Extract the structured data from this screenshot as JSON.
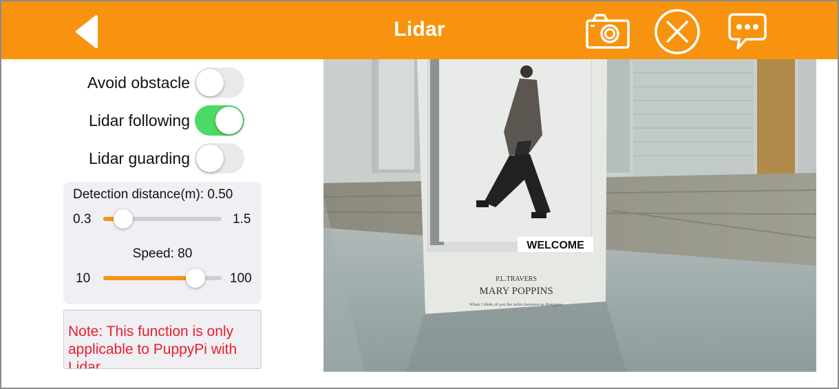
{
  "header": {
    "title": "Lidar",
    "back_icon": "back-arrow-icon",
    "camera_icon": "camera-icon",
    "close_icon": "close-circle-icon",
    "chat_icon": "chat-bubble-icon",
    "color": "#f7930f"
  },
  "toggles": [
    {
      "label": "Avoid obstacle",
      "on": false
    },
    {
      "label": "Lidar following",
      "on": true
    },
    {
      "label": "Lidar guarding",
      "on": false
    }
  ],
  "detection": {
    "label": "Detection distance(m): 0.50",
    "min": "0.3",
    "max": "1.5",
    "value": 0.5
  },
  "speed": {
    "label": "Speed: 80",
    "min": "10",
    "max": "100",
    "value": 80
  },
  "note": "Note: This function is only applicable to PuppyPi with Lidar.",
  "feed": {
    "poster_sign": "WELCOME",
    "poster_author": "P.L.TRAVERS",
    "poster_title": "MARY POPPINS",
    "poster_tagline": "When I think of you the miles between us disappear."
  }
}
